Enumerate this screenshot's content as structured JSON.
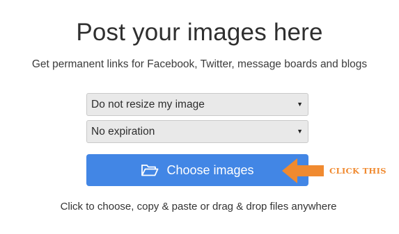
{
  "header": {
    "title": "Post your images here",
    "subtitle": "Get permanent links for Facebook, Twitter, message boards and blogs"
  },
  "resize_select": {
    "selected": "Do not resize my image"
  },
  "expiration_select": {
    "selected": "No expiration"
  },
  "upload": {
    "button_label": "Choose images",
    "icon": "folder-open-icon",
    "accent_color": "#4286e5"
  },
  "callout": {
    "text": "CLICK THIS",
    "color": "#f08a30",
    "icon": "arrow-left-icon"
  },
  "hint": {
    "text": "Click to choose, copy & paste or drag & drop files anywhere"
  }
}
